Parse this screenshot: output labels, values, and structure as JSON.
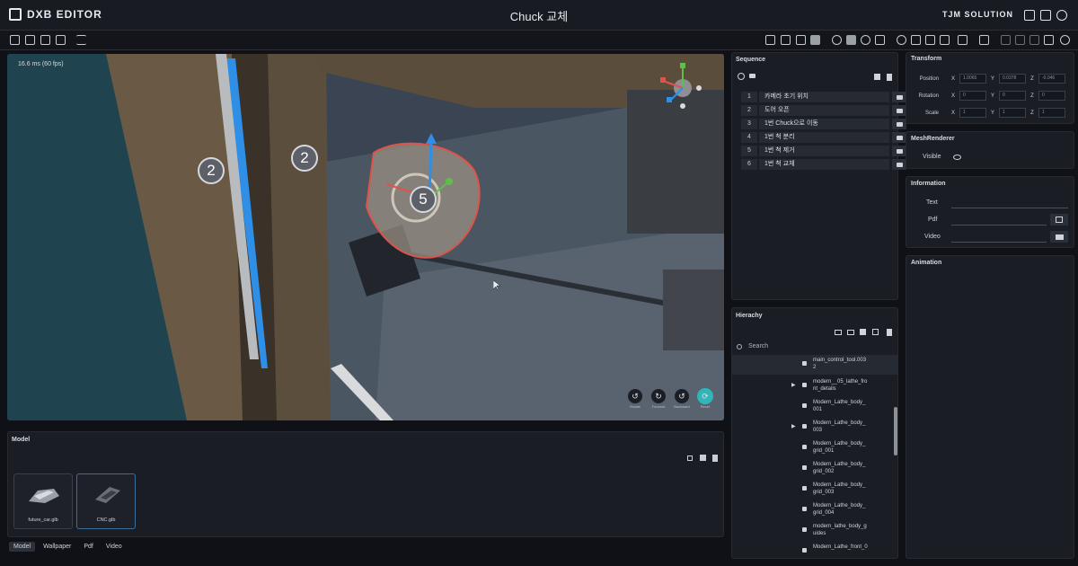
{
  "app": {
    "logo_text": "DXB EDITOR",
    "title": "Chuck 교체",
    "brand": "TJM SOLUTION"
  },
  "viewport": {
    "fps": "16.6 ms (60 fps)",
    "markers": [
      "2",
      "2",
      "5"
    ],
    "controls": [
      "Rotate",
      "Forward",
      "Backward",
      "Reset"
    ]
  },
  "sequence": {
    "title": "Sequence",
    "rows": [
      {
        "num": "1",
        "label": "카메라 초기 위치"
      },
      {
        "num": "2",
        "label": "도어 오픈"
      },
      {
        "num": "3",
        "label": "1번 Chuck으로 이동"
      },
      {
        "num": "4",
        "label": "1번 척 분리"
      },
      {
        "num": "5",
        "label": "1번 척 제거"
      },
      {
        "num": "6",
        "label": "1번 척 교체"
      }
    ]
  },
  "transform": {
    "title": "Transform",
    "rows": [
      {
        "label": "Position",
        "x": "1.0065",
        "y": "0.0378",
        "z": "-0.046"
      },
      {
        "label": "Rotation",
        "x": "0",
        "y": "0",
        "z": "0"
      },
      {
        "label": "Scale",
        "x": "1",
        "y": "1",
        "z": "1"
      }
    ]
  },
  "meshrenderer": {
    "title": "MeshRenderer",
    "visible_label": "Visible"
  },
  "information": {
    "title": "Information",
    "text_label": "Text",
    "pdf_label": "Pdf",
    "video_label": "Video"
  },
  "animation": {
    "title": "Animation"
  },
  "hierarchy": {
    "title": "Hierachy",
    "search_placeholder": "Search",
    "items": [
      {
        "line1": "main_control_tool.003",
        "line2": "2",
        "arrow": false
      },
      {
        "line1": "modern__05_lathe_fro",
        "line2": "nt_details",
        "arrow": true
      },
      {
        "line1": "Modern_Lathe_body_",
        "line2": "001",
        "arrow": false
      },
      {
        "line1": "Modern_Lathe_body_",
        "line2": "003",
        "arrow": true
      },
      {
        "line1": "Modern_Lathe_body_",
        "line2": "grid_001",
        "arrow": false
      },
      {
        "line1": "Modern_Lathe_body_",
        "line2": "grid_002",
        "arrow": false
      },
      {
        "line1": "Modern_Lathe_body_",
        "line2": "grid_003",
        "arrow": false
      },
      {
        "line1": "Modern_Lathe_body_",
        "line2": "grid_004",
        "arrow": false
      },
      {
        "line1": "modern_lathe_body_g",
        "line2": "uides",
        "arrow": false
      },
      {
        "line1": "Modern_Lathe_front_0",
        "line2": "",
        "arrow": false
      }
    ]
  },
  "model_panel": {
    "title": "Model",
    "cards": [
      {
        "name": "future_car.glb"
      },
      {
        "name": "CNC.glb"
      }
    ]
  },
  "bottom_tabs": [
    "Model",
    "Wallpaper",
    "Pdf",
    "Video"
  ],
  "colors": {
    "accent_blue": "#2f8fe6",
    "outline_red": "#e0534a",
    "reset_teal": "#2fb6b8"
  }
}
